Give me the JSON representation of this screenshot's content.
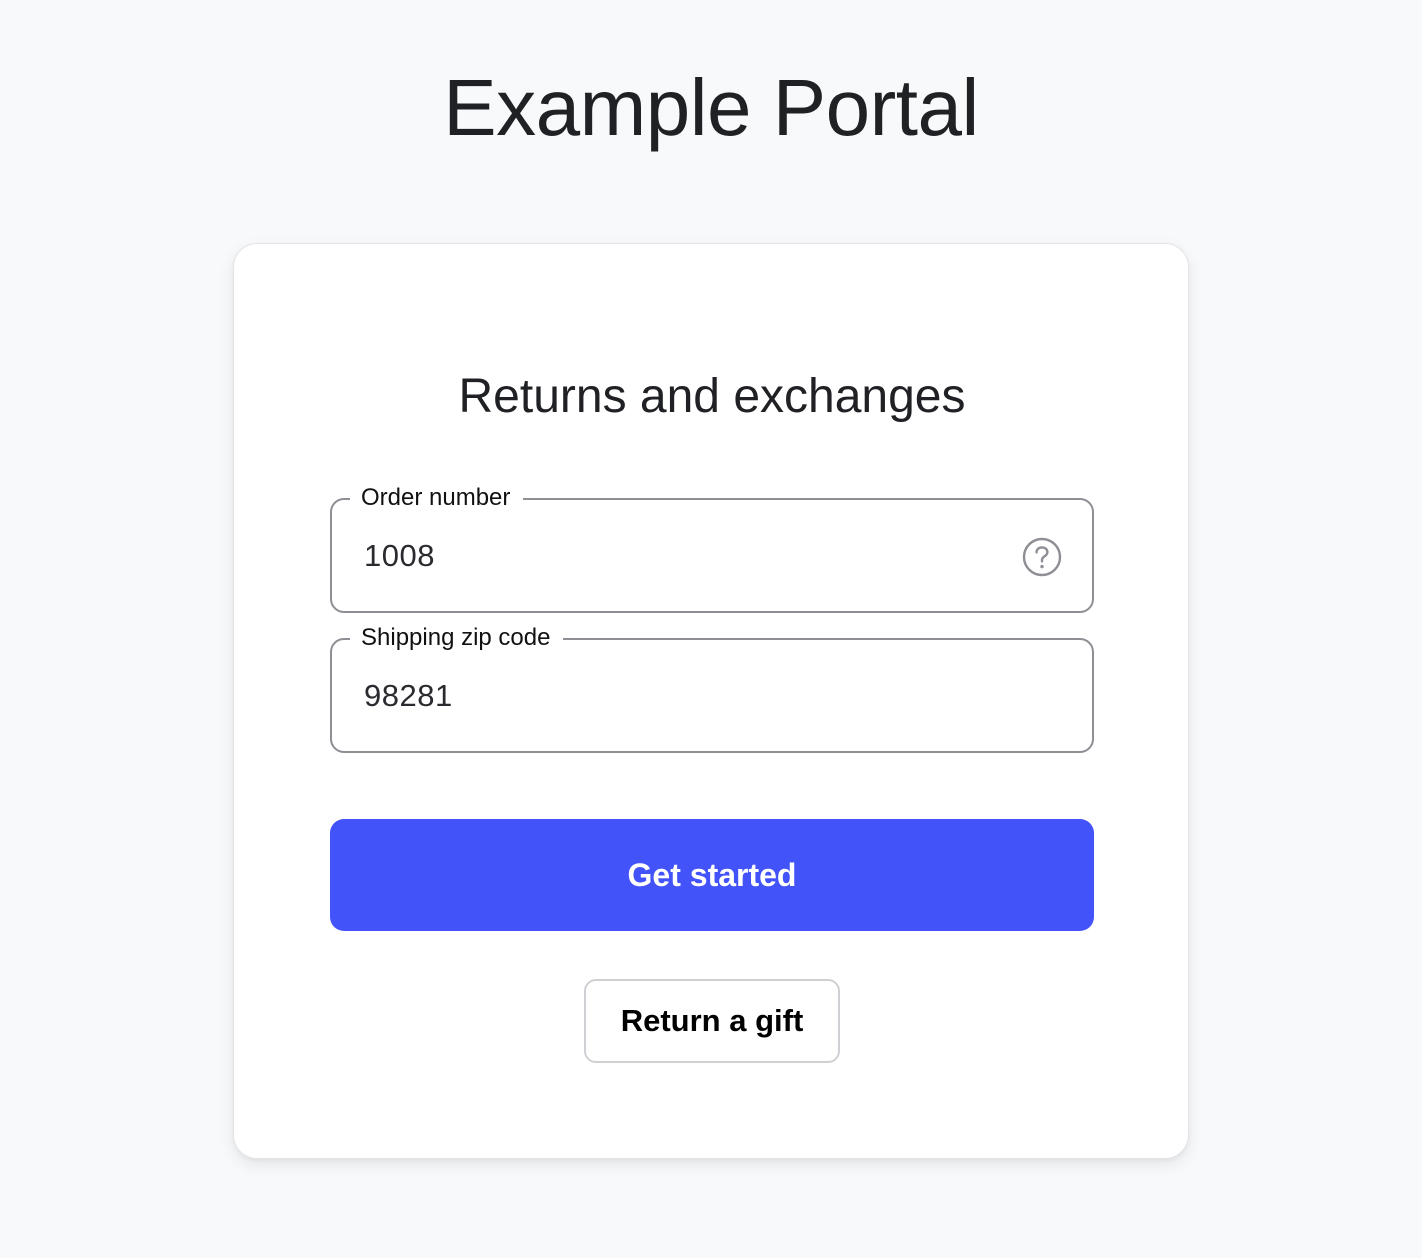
{
  "header": {
    "title": "Example Portal"
  },
  "form": {
    "title": "Returns and exchanges",
    "order_number": {
      "label": "Order number",
      "value": "1008",
      "help_icon": "question-circle-icon"
    },
    "zip_code": {
      "label": "Shipping zip code",
      "value": "98281"
    },
    "submit_label": "Get started",
    "gift_label": "Return a gift"
  },
  "colors": {
    "accent": "#4353fa",
    "background": "#f8f9fb",
    "card": "#ffffff",
    "field_border": "#8d8f94"
  }
}
